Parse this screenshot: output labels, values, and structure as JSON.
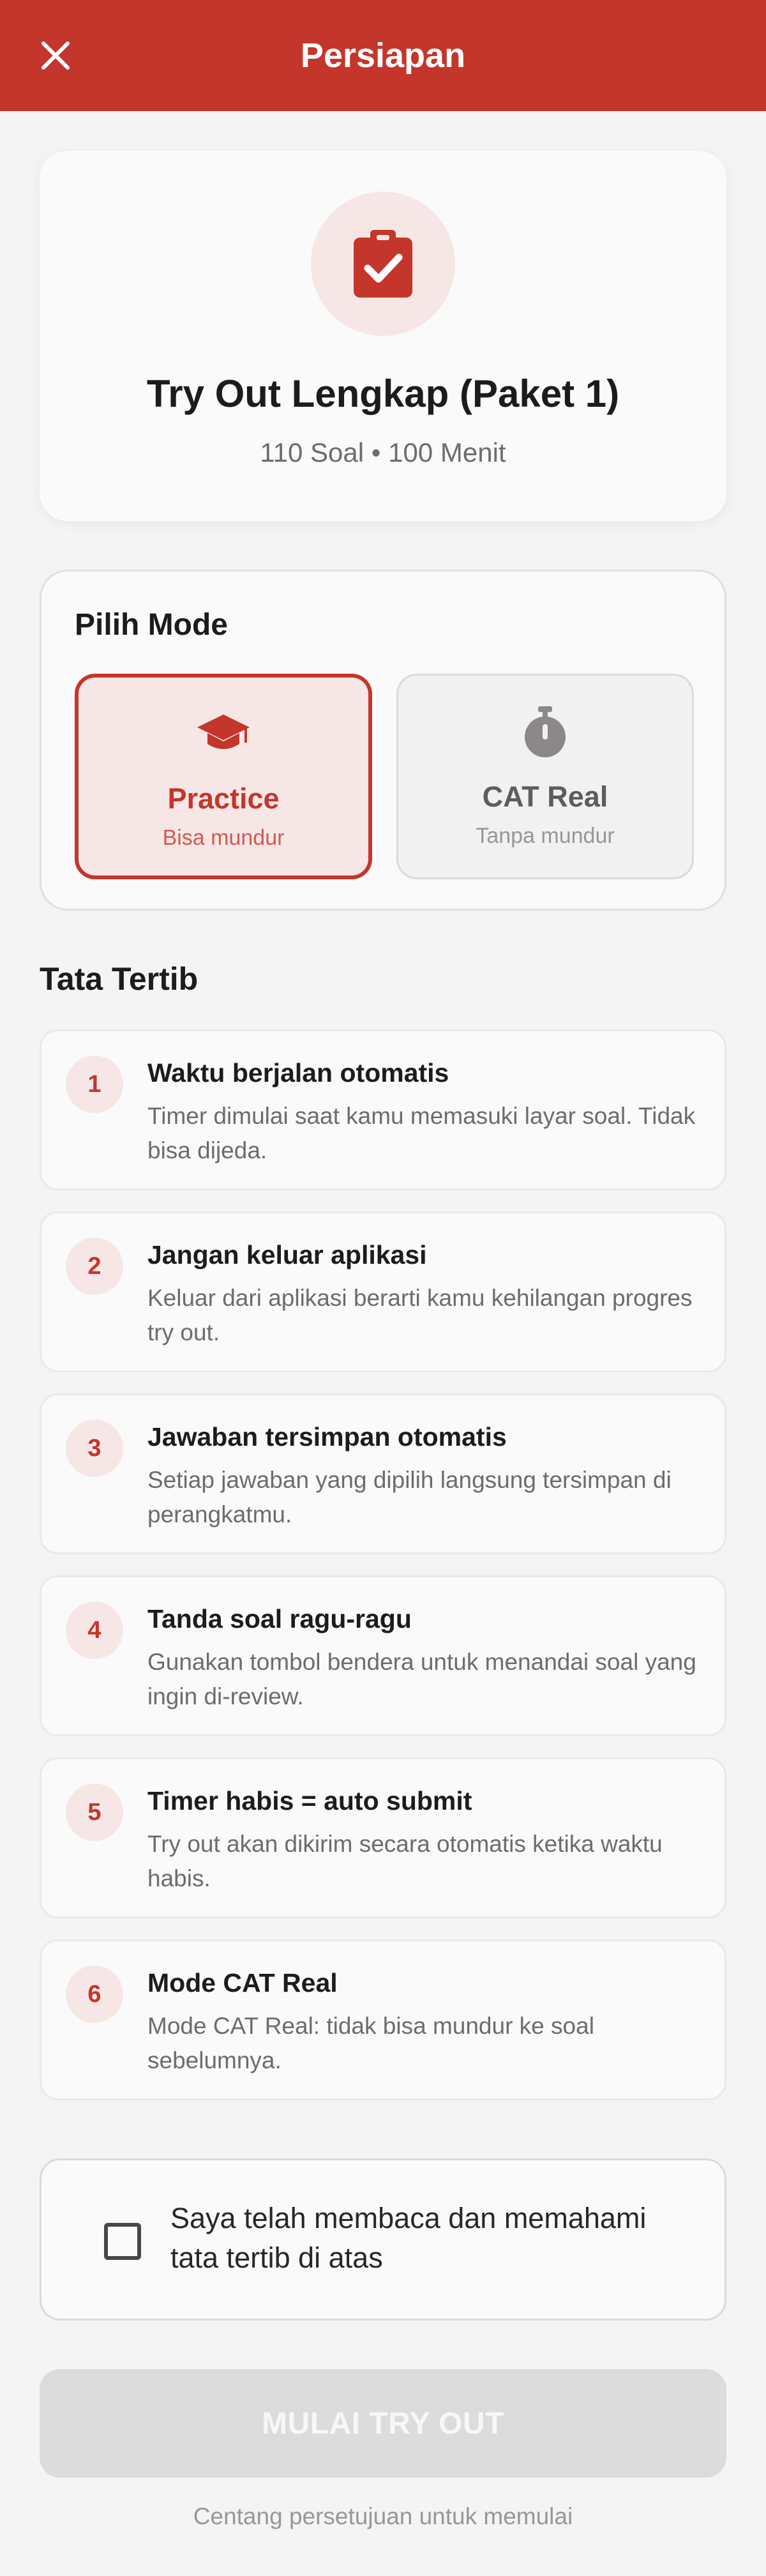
{
  "appbar": {
    "title": "Persiapan",
    "close_icon": "close-icon"
  },
  "hero": {
    "icon": "clipboard-check-icon",
    "title": "Try Out Lengkap (Paket 1)",
    "meta": "110 Soal • 100 Menit"
  },
  "mode": {
    "heading": "Pilih Mode",
    "selected": "practice",
    "options": [
      {
        "id": "practice",
        "icon": "graduation-cap-icon",
        "label": "Practice",
        "desc": "Bisa mundur"
      },
      {
        "id": "cat",
        "icon": "stopwatch-icon",
        "label": "CAT Real",
        "desc": "Tanpa mundur"
      }
    ]
  },
  "rules": {
    "heading": "Tata Tertib",
    "items": [
      {
        "num": "1",
        "title": "Waktu berjalan otomatis",
        "desc": "Timer dimulai saat kamu memasuki layar soal. Tidak bisa dijeda."
      },
      {
        "num": "2",
        "title": "Jangan keluar aplikasi",
        "desc": "Keluar dari aplikasi berarti kamu kehilangan progres try out."
      },
      {
        "num": "3",
        "title": "Jawaban tersimpan otomatis",
        "desc": "Setiap jawaban yang dipilih langsung tersimpan di perangkatmu."
      },
      {
        "num": "4",
        "title": "Tanda soal ragu-ragu",
        "desc": "Gunakan tombol bendera untuk menandai soal yang ingin di-review."
      },
      {
        "num": "5",
        "title": "Timer habis = auto submit",
        "desc": "Try out akan dikirim secara otomatis ketika waktu habis."
      },
      {
        "num": "6",
        "title": "Mode CAT Real",
        "desc": "Mode CAT Real: tidak bisa mundur ke soal sebelumnya."
      }
    ]
  },
  "agreement": {
    "checked": false,
    "text": "Saya telah membaca dan memahami tata tertib di atas"
  },
  "start_button": {
    "label": "MULAI TRY OUT",
    "enabled": false
  },
  "hint": "Centang persetujuan untuk memulai",
  "colors": {
    "primary": "#c4362b",
    "primary_light": "#f6e7e6",
    "background": "#f4f4f4",
    "disabled": "#dcdcdc"
  }
}
